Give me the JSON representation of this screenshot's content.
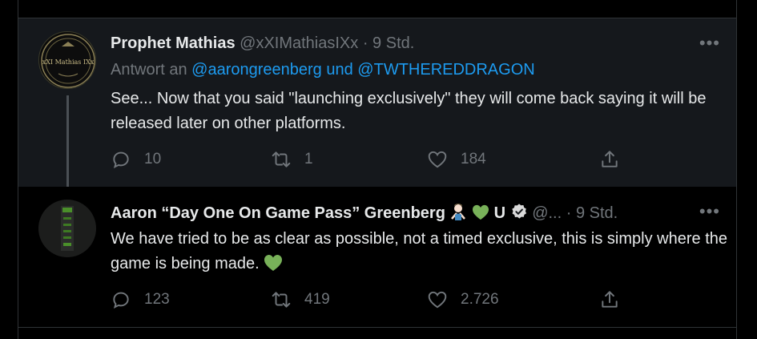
{
  "tweet1": {
    "author_name": "Prophet Mathias",
    "handle": "@xXIMathiasIXx",
    "separator": " · ",
    "time": "9 Std.",
    "more": "•••",
    "reply_prefix": "Antwort an ",
    "reply_mention_1": "@aarongreenberg",
    "reply_and": " und ",
    "reply_mention_2": "@TWTHEREDDRAGON",
    "text": "See... Now that you said \"launching exclusively\" they will come back saying it will be released later on other platforms.",
    "avatar_label": "xXI Mathias IXx",
    "replies": "10",
    "retweets": "1",
    "likes": "184"
  },
  "tweet2": {
    "author_name": "Aaron “Day One On Game Pass” Greenberg",
    "name_suffix": "U",
    "handle": "@...",
    "separator": " · ",
    "time": "9 Std.",
    "more": "•••",
    "text": "We have tried to be as clear as possible, not a timed exclusive, this is simply where the game is being made.",
    "replies": "123",
    "retweets": "419",
    "likes": "2.726"
  },
  "colors": {
    "background": "#000000",
    "card": "#15181c",
    "text": "#e7e9ea",
    "muted": "#71767b",
    "link": "#1d9bf0",
    "verified": "#d9d9d9",
    "heart_emoji": "#78b159"
  },
  "icons": [
    "reply-icon",
    "retweet-icon",
    "like-icon",
    "share-icon",
    "verified-icon",
    "green-heart-emoji",
    "person-gesturing-no-emoji"
  ]
}
